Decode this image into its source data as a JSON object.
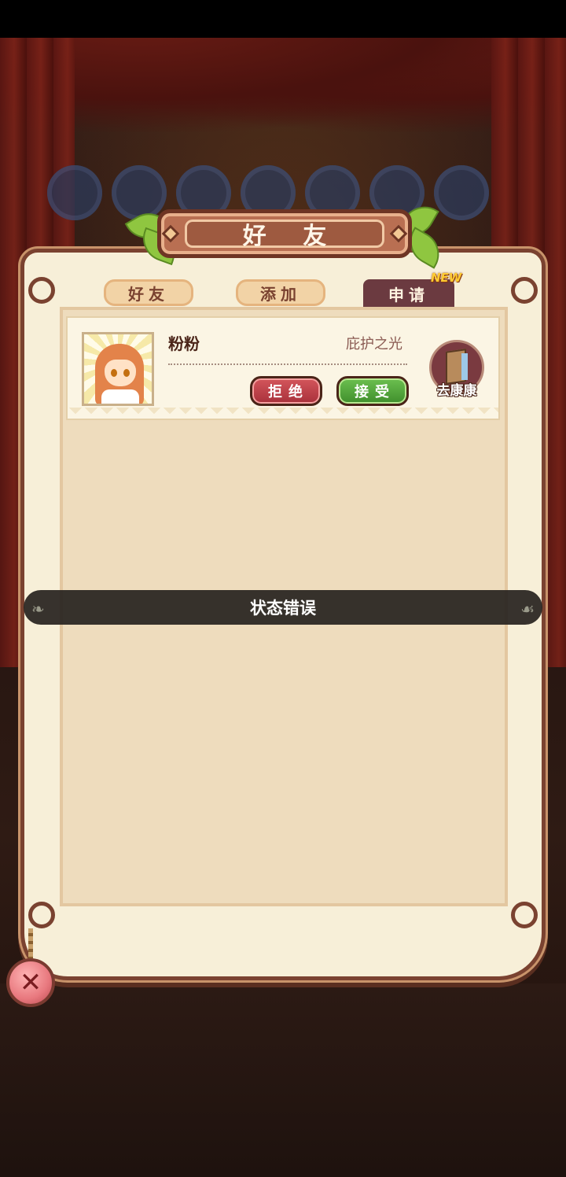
{
  "header": {
    "title": "好 友"
  },
  "tabs": [
    {
      "label": "好友",
      "active": false
    },
    {
      "label": "添加",
      "active": false
    },
    {
      "label": "申请",
      "active": true,
      "badge": "NEW"
    }
  ],
  "requests": [
    {
      "name": "粉粉",
      "title": "庇护之光",
      "reject_label": "拒绝",
      "accept_label": "接受",
      "visit_label": "去康康"
    }
  ],
  "toast": {
    "message": "状态错误"
  },
  "close": {
    "icon": "close-icon",
    "glyph": "✕"
  },
  "colors": {
    "accept": "#4ea63a",
    "reject": "#c0404a",
    "accent": "#7a4230",
    "badge": "#ffcc33"
  }
}
